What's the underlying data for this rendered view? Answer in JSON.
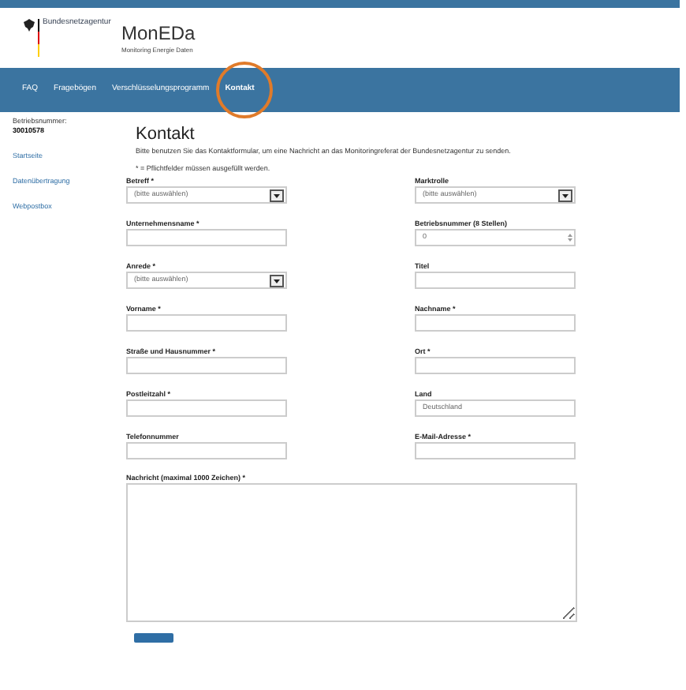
{
  "header": {
    "agency": "Bundesnetzagentur",
    "title": "MonEDa",
    "subtitle": "Monitoring Energie Daten"
  },
  "nav": [
    {
      "label": "FAQ",
      "selected": false
    },
    {
      "label": "Fragebögen",
      "selected": false
    },
    {
      "label": "Verschlüsselungsprogramm",
      "selected": false
    },
    {
      "label": "Kontakt",
      "selected": true
    }
  ],
  "sidebar": {
    "label": "Betriebsnummer:",
    "number": "30010578",
    "items": [
      {
        "label": "Startseite"
      },
      {
        "label": "Datenübertragung"
      },
      {
        "label": "Webpostbox"
      }
    ]
  },
  "page": {
    "title": "Kontakt",
    "intro": "Bitte benutzen Sie das Kontaktformular, um eine Nachricht an das Monitoringreferat der Bundesnetzagentur zu senden.",
    "note": "* = Pflichtfelder müssen ausgefüllt werden."
  },
  "fields": [
    {
      "label": "Betreff *",
      "kind": "select",
      "value": "(bitte auswählen)"
    },
    {
      "label": "Marktrolle",
      "kind": "select",
      "value": "(bitte auswählen)"
    },
    {
      "label": "Unternehmensname *",
      "kind": "input"
    },
    {
      "label": "Betriebsnummer (8 Stellen)",
      "kind": "number",
      "value": "0"
    },
    {
      "label": "Anrede *",
      "kind": "select",
      "value": "(bitte auswählen)"
    },
    {
      "label": "Titel",
      "kind": "input"
    },
    {
      "label": "Vorname *",
      "kind": "input"
    },
    {
      "label": "Nachname *",
      "kind": "input"
    },
    {
      "label": "Straße und Hausnummer *",
      "kind": "input"
    },
    {
      "label": "Ort *",
      "kind": "input"
    },
    {
      "label": "Postleitzahl *",
      "kind": "input"
    },
    {
      "label": "Land",
      "kind": "input",
      "value": "Deutschland"
    },
    {
      "label": "Telefonnummer",
      "kind": "input"
    },
    {
      "label": "E-Mail-Adresse *",
      "kind": "input"
    }
  ],
  "message": {
    "label": "Nachricht (maximal 1000 Zeichen) *"
  }
}
